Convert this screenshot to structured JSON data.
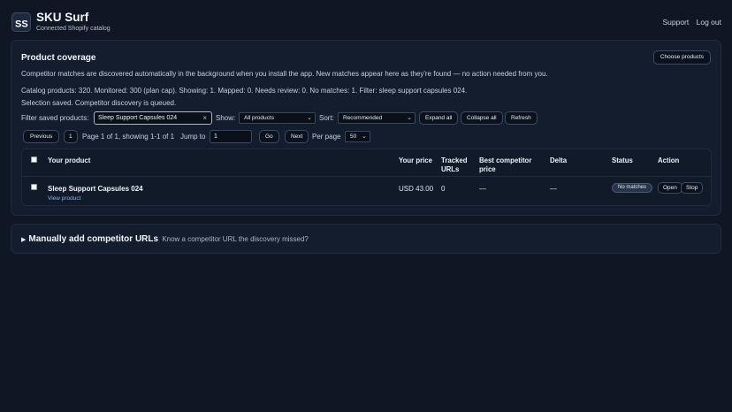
{
  "app": {
    "title": "SKU Surf",
    "subtitle": "Connected Shopify catalog",
    "logo_text": "SS"
  },
  "header": {
    "support_label": "Support",
    "logout_label": "Log out"
  },
  "coverage": {
    "title": "Product coverage",
    "choose_label": "Choose products",
    "info_text": "Competitor matches are discovered automatically in the background when you install the app. New matches appear here as they're found — no action needed from you.",
    "stats_text": "Catalog products: 320. Monitored: 300 (plan cap). Showing: 1. Mapped: 0. Needs review: 0. No matches: 1. Filter: sleep support capsules 024.",
    "status_text": "Selection saved. Competitor discovery is queued.",
    "filter_label": "Filter saved products:",
    "filter_value": "Sleep Support Capsules 024",
    "clear_glyph": "×",
    "show_label": "Show:",
    "show_value": "All products",
    "sort_label": "Sort:",
    "sort_value": "Recommended",
    "expand_label": "Expand all",
    "collapse_label": "Collapse all",
    "refresh_label": "Refresh"
  },
  "pagination": {
    "previous_label": "Previous",
    "current_page": "1",
    "summary_text": "Page 1 of 1, showing 1-1 of 1",
    "jump_label": "Jump to",
    "jump_value": "1",
    "go_label": "Go",
    "next_label": "Next",
    "per_page_label": "Per page",
    "per_page_value": "50"
  },
  "table": {
    "headers": {
      "product": "Your product",
      "price": "Your price",
      "tracked_line1": "Tracked",
      "tracked_line2": "URLs",
      "best_line1": "Best competitor",
      "best_line2": "price",
      "delta": "Delta",
      "status": "Status",
      "action": "Action"
    },
    "rows": [
      {
        "product": "Sleep Support Capsules 024",
        "view_label": "View product",
        "price": "USD 43.00",
        "tracked": "0",
        "best": "—",
        "delta": "—",
        "status": "No matches",
        "open_label": "Open",
        "stop_label": "Stop"
      }
    ]
  },
  "manual": {
    "toggle_glyph": "▶",
    "title": "Manually add competitor URLs",
    "hint": "Know a competitor URL the discovery missed?"
  }
}
